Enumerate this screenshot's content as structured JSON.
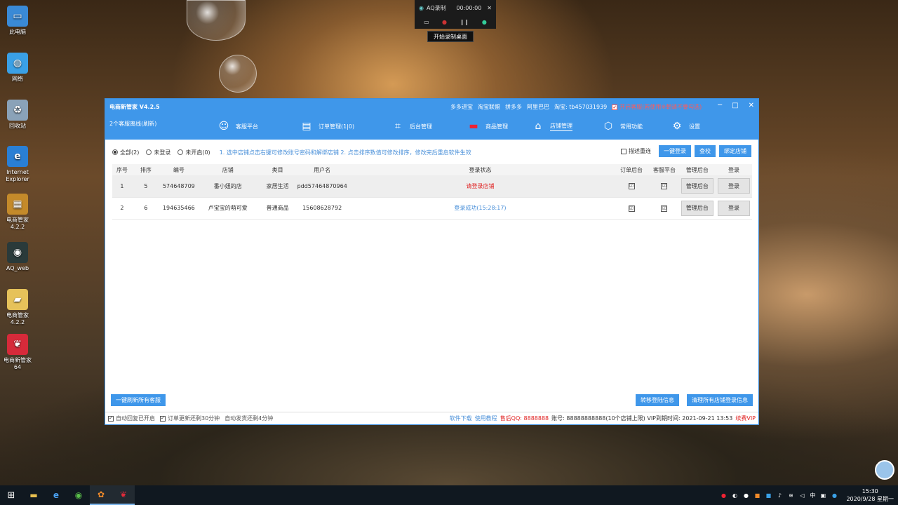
{
  "desktop": {
    "icons": [
      {
        "label": "此电脑",
        "icon": "computer-icon",
        "color": "#3a8ad6"
      },
      {
        "label": "网络",
        "icon": "network-icon",
        "color": "#3aa0e6"
      },
      {
        "label": "回收站",
        "icon": "recycle-bin-icon",
        "color": "#8aa2b8"
      },
      {
        "label": "Internet Explorer",
        "icon": "ie-icon",
        "color": "#2a7fd4"
      },
      {
        "label": "电商管家 4.2.2",
        "icon": "archive-icon",
        "color": "#c48a2a"
      },
      {
        "label": "AQ_web",
        "icon": "aq-icon",
        "color": "#2a3a3a"
      },
      {
        "label": "电商管家 4.2.2",
        "icon": "folder-icon",
        "color": "#e6c25a"
      },
      {
        "label": "电商新管家 64",
        "icon": "app-icon",
        "color": "#d62a3a"
      }
    ]
  },
  "recorder": {
    "title": "AQ录制",
    "time": "00:00:00",
    "tooltip": "开始录制桌面"
  },
  "app": {
    "title": "电商新管家    V4.2.5",
    "subtitle": "2个客服离线(刷新)",
    "top_links": [
      "多多进宝",
      "淘宝联盟",
      "拼多多",
      "阿里巴巴",
      "淘宝: tb457031939"
    ],
    "warn_option": "开启客服(若使用※朝请不要勾选)",
    "nav": [
      {
        "label": "客服平台",
        "icon": "chat-icon"
      },
      {
        "label": "订单管理(1|0)",
        "icon": "order-icon"
      },
      {
        "label": "后台管理",
        "icon": "chart-icon"
      },
      {
        "label": "商品管理",
        "icon": "goods-icon"
      },
      {
        "label": "店铺管理",
        "icon": "store-icon"
      },
      {
        "label": "常用功能",
        "icon": "box-icon"
      },
      {
        "label": "设置",
        "icon": "gear-icon"
      }
    ],
    "filters": {
      "all": "全部(2)",
      "not_logged": "未登录",
      "not_open": "未开启(0)"
    },
    "hint": "1. 选中店铺点击右键可修改账号密码和解绑店铺    2. 点击排序数值可修改排序，修改完后重启软件生效",
    "toolbar": {
      "check_label": "描述重连",
      "login_all": "一键登录",
      "check": "查校",
      "bind": "绑定店铺"
    },
    "table": {
      "headers": [
        "序号",
        "排序",
        "编号",
        "店铺",
        "类目",
        "用户名",
        "登录状态",
        "订单后台",
        "客服平台",
        "管理后台",
        "登录"
      ],
      "rows": [
        {
          "no": "1",
          "sort": "5",
          "id": "574648709",
          "shop": "番小妞的店",
          "category": "家居生活",
          "user": "pdd57464870964",
          "status": "请登录店铺",
          "status_color": "#e02020",
          "order": "☑",
          "service": "☑",
          "manage": "管理后台",
          "login": "登录"
        },
        {
          "no": "2",
          "sort": "6",
          "id": "194635466",
          "shop": "卢宝宝的萌可爱",
          "category": "普通商品",
          "user": "15608628792",
          "status": "登录成功(15:28:17)",
          "status_color": "#4a90d9",
          "order": "☑",
          "service": "☑",
          "manage": "管理后台",
          "login": "登录"
        }
      ]
    },
    "buttons": {
      "refresh_all": "一键刷新所有客服",
      "transfer": "转移登陆信息",
      "clear": "清理所有店铺登录信息"
    },
    "status": {
      "auto_reply": "自动回复已开启",
      "order_update": "订单更新还剩30分钟",
      "auto_ship": "自动发货还剩4分钟",
      "download": "软件下载",
      "tutorial": "使用教程",
      "qq": "售后QQ: 8888888",
      "account": "账号: 88888888888(10个店铺上限)  VIP到期时间: 2021-09-21 13:53",
      "renew": "续费VIP"
    }
  },
  "taskbar": {
    "time": "15:30",
    "date": "2020/9/28 星期一",
    "ime": "中"
  }
}
